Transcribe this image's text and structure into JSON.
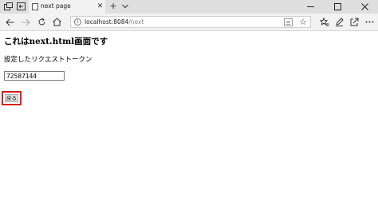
{
  "browser": {
    "tab": {
      "title": "next page"
    },
    "address": {
      "host": "localhost:8084",
      "path": "/next"
    },
    "icons": {
      "tab_manager": "tab-manager-icon",
      "set_aside": "set-aside-tabs-icon",
      "favicon": "page-icon",
      "close_tab": "close-icon",
      "new_tab": "plus-icon",
      "tab_list": "chevron-down-icon",
      "minimize": "minimize-icon",
      "maximize": "maximize-icon",
      "close_window": "close-icon",
      "back": "back-arrow-icon",
      "forward": "forward-arrow-icon",
      "refresh": "refresh-icon",
      "home": "home-icon",
      "site_info": "info-icon",
      "reading_view": "reading-view-icon",
      "favorite": "star-icon",
      "favorites_hub": "favorites-icon",
      "notes": "pen-icon",
      "share": "share-icon",
      "more": "more-icon"
    }
  },
  "page": {
    "heading": "これはnext.html画面です",
    "token_label": "設定したリクエストトークン",
    "token_value": "72587144",
    "back_button_label": "戻る"
  },
  "colors": {
    "tab_strip": "#dfdfdf",
    "toolbar": "#f2f2f2",
    "focus_outline": "#d61f1f"
  }
}
